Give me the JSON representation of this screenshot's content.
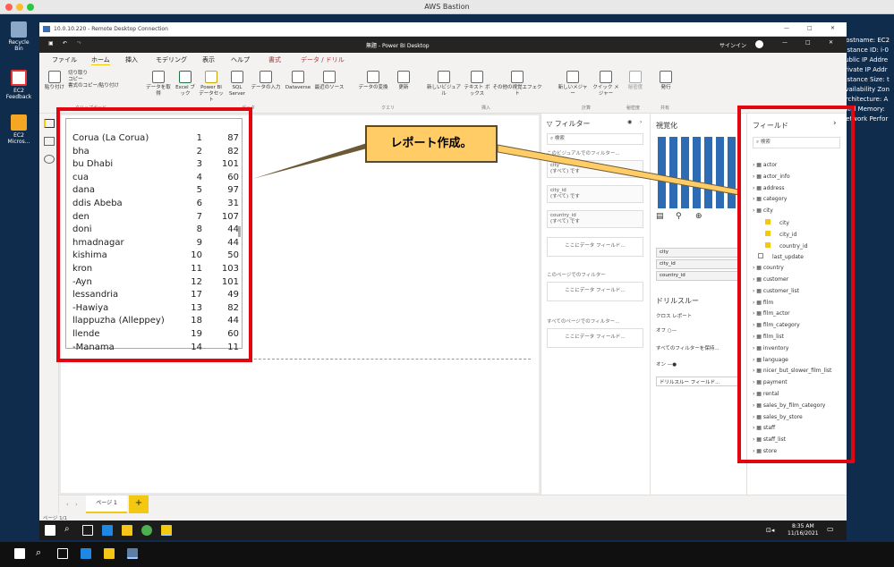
{
  "mac_title": "AWS Bastion",
  "rdp_title": "10.0.10.220 - Remote Desktop Connection",
  "desktop": {
    "icons": [
      "Recycle Bin",
      "EC2 Feedback",
      "EC2 Micros..."
    ],
    "info_lines": [
      "Hostname: EC2",
      "Instance ID: i-0",
      "Public IP Addre",
      "Private IP Addr",
      "Instance Size: t",
      "Availability Zon",
      "Architecture: A",
      "Total Memory:",
      "Network Perfor"
    ]
  },
  "pbi": {
    "title": "無題 - Power BI Desktop",
    "signin": "サインイン",
    "tabs": [
      "ファイル",
      "ホーム",
      "挿入",
      "モデリング",
      "表示",
      "ヘルプ",
      "書式",
      "データ / ドリル"
    ],
    "clipboard": {
      "paste": "貼り付け",
      "cut": "切り取り",
      "copy": "コピー",
      "format": "書式のコピー/貼り付け"
    },
    "ribbon_buttons": [
      "データを取得",
      "Excel ブック",
      "Power BI データセット",
      "SQL Server",
      "データの入力",
      "Dataverse",
      "最近のソース",
      "データの変換",
      "更新",
      "新しいビジュアル",
      "テキスト ボックス",
      "その他の視覚エフェクト",
      "新しいメジャー",
      "クイック メジャー",
      "秘密度",
      "発行"
    ],
    "groups": [
      "クリップボード",
      "データ",
      "クエリ",
      "挿入",
      "計算",
      "秘密度",
      "共有"
    ]
  },
  "table_rows": [
    [
      "Corua (La Corua)",
      "1",
      "87"
    ],
    [
      "bha",
      "2",
      "82"
    ],
    [
      "bu Dhabi",
      "3",
      "101"
    ],
    [
      "cua",
      "4",
      "60"
    ],
    [
      "dana",
      "5",
      "97"
    ],
    [
      "ddis Abeba",
      "6",
      "31"
    ],
    [
      "den",
      "7",
      "107"
    ],
    [
      "doni",
      "8",
      "44"
    ],
    [
      "hmadnagar",
      "9",
      "44"
    ],
    [
      "kishima",
      "10",
      "50"
    ],
    [
      "kron",
      "11",
      "103"
    ],
    [
      "-Ayn",
      "12",
      "101"
    ],
    [
      "lessandria",
      "17",
      "49"
    ],
    [
      "-Hawiya",
      "13",
      "82"
    ],
    [
      "llappuzha (Alleppey)",
      "18",
      "44"
    ],
    [
      "llende",
      "19",
      "60"
    ],
    [
      "-Manama",
      "14",
      "11"
    ]
  ],
  "callout": "レポート作成。",
  "filters": {
    "title": "フィルター",
    "search": "検索",
    "visual_filter_label": "このビジュアルでのフィルター...",
    "cards": [
      {
        "name": "city",
        "value": "(すべて) です"
      },
      {
        "name": "city_id",
        "value": "(すべて) です"
      },
      {
        "name": "country_id",
        "value": "(すべて) です"
      }
    ],
    "add_field": "ここにデータ フィールド...",
    "page_filter_label": "このページでのフィルター",
    "all_pages_label": "すべてのページでのフィルター..."
  },
  "viz": {
    "title": "視覚化",
    "wells": [
      "city",
      "city_id",
      "country_id"
    ],
    "drill_title": "ドリルスルー",
    "cross_report": "クロス レポート",
    "off": "オフ",
    "keep_all": "すべてのフィルターを保持...",
    "on": "オン",
    "drill_add": "ドリルスルー フィールド..."
  },
  "fields": {
    "title": "フィールド",
    "search": "検索",
    "tables": [
      "actor",
      "actor_info",
      "address",
      "category",
      "city",
      "country",
      "customer",
      "customer_list",
      "film",
      "film_actor",
      "film_category",
      "film_list",
      "inventory",
      "language",
      "nicer_but_slower_film_list",
      "payment",
      "rental",
      "sales_by_film_category",
      "sales_by_store",
      "staff",
      "staff_list",
      "store"
    ],
    "city_columns": [
      "city",
      "city_id",
      "country_id",
      "last_update"
    ]
  },
  "page_tab": "ページ 1",
  "page_status": "ページ 1/1",
  "clock": {
    "time": "8:35 AM",
    "date": "11/16/2021"
  },
  "colors": {
    "accent_red": "#e20613",
    "callout": "#ffcc66",
    "pbi_yellow": "#f2c811"
  }
}
